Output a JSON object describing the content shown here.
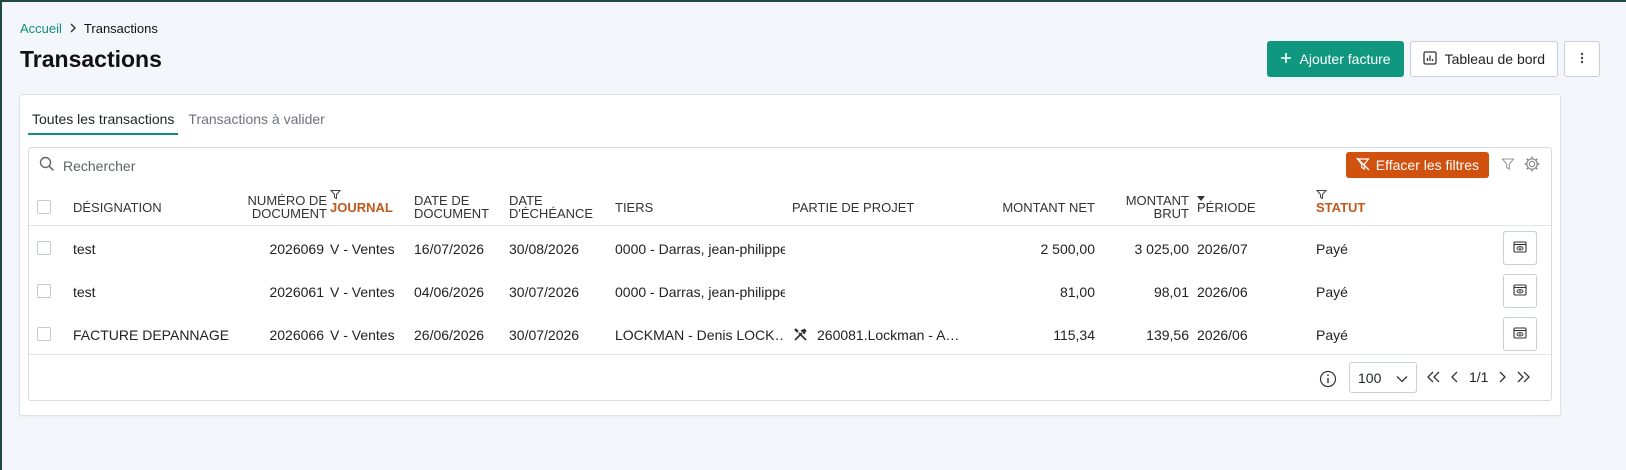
{
  "breadcrumb": {
    "home": "Accueil",
    "current": "Transactions"
  },
  "page_title": "Transactions",
  "actions": {
    "add_invoice": "Ajouter facture",
    "dashboard": "Tableau de bord"
  },
  "tabs": [
    {
      "label": "Toutes les transactions",
      "active": true
    },
    {
      "label": "Transactions à valider",
      "active": false
    }
  ],
  "search": {
    "placeholder": "Rechercher"
  },
  "clear_filters": "Effacer les filtres",
  "columns": {
    "designation": "Désignation",
    "numero_1": "Numéro de",
    "numero_2": "document",
    "journal": "Journal",
    "date_doc_1": "Date de",
    "date_doc_2": "document",
    "date_ech_1": "Date",
    "date_ech_2": "d'échéance",
    "tiers": "Tiers",
    "partie": "Partie de projet",
    "montant_net": "Montant net",
    "montant_brut_1": "Montant",
    "montant_brut_2": "brut",
    "periode": "Période",
    "statut": "Statut"
  },
  "rows": [
    {
      "designation": "test",
      "numero": "2026069",
      "journal": "V - Ventes",
      "date_doc": "16/07/2026",
      "date_ech": "30/08/2026",
      "tiers": "0000 - Darras, jean-philippe",
      "partie": "",
      "net": "2 500,00",
      "brut": "3 025,00",
      "periode": "2026/07",
      "statut": "Payé"
    },
    {
      "designation": "test",
      "numero": "2026061",
      "journal": "V - Ventes",
      "date_doc": "04/06/2026",
      "date_ech": "30/07/2026",
      "tiers": "0000 - Darras, jean-philippe",
      "partie": "",
      "net": "81,00",
      "brut": "98,01",
      "periode": "2026/06",
      "statut": "Payé"
    },
    {
      "designation": "FACTURE DEPANNAGE",
      "numero": "2026066",
      "journal": "V - Ventes",
      "date_doc": "26/06/2026",
      "date_ech": "30/07/2026",
      "tiers": "LOCKMAN - Denis LOCK…",
      "partie": "260081.Lockman - A…",
      "net": "115,34",
      "brut": "139,56",
      "periode": "2026/06",
      "statut": "Payé"
    }
  ],
  "pagination": {
    "page_size": "100",
    "page": "1/1"
  },
  "colors": {
    "accent": "#10977f",
    "warning": "#d1510f",
    "filtered_header": "#c0581b"
  }
}
